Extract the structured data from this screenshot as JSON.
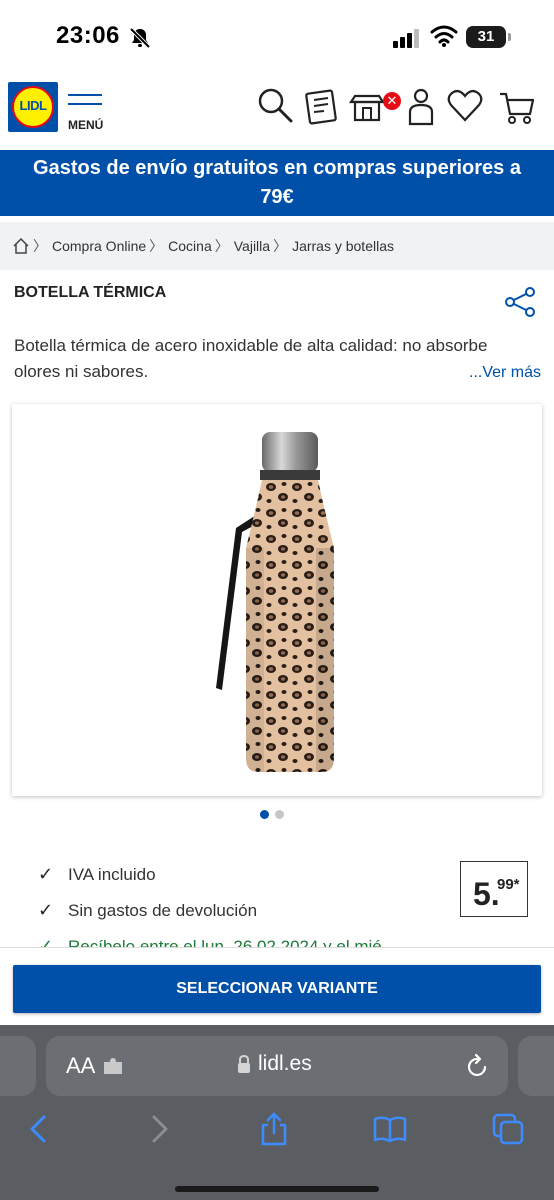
{
  "status_bar": {
    "time": "23:06",
    "battery": "31",
    "icons": [
      "bell-slash-icon",
      "signal-icon",
      "wifi-icon",
      "battery-icon"
    ]
  },
  "header": {
    "logo_text": "LIDL",
    "menu_label": "MENÚ",
    "icons": [
      "search-icon",
      "brochure-icon",
      "store-icon",
      "user-icon",
      "heart-icon",
      "cart-icon"
    ],
    "store_badge": "✕"
  },
  "banner": {
    "text": "Gastos de envío gratuitos en compras superiores a 79€"
  },
  "breadcrumb": {
    "items": [
      "Compra Online",
      "Cocina",
      "Vajilla",
      "Jarras y botellas"
    ]
  },
  "product": {
    "title": "BOTELLA TÉRMICA",
    "description": "Botella térmica de acero inoxidable de alta calidad: no absorbe olores ni sabores.",
    "more_link": "...Ver más",
    "carousel_pages": 2,
    "carousel_active": 1
  },
  "benefits": {
    "iva": "IVA incluido",
    "returns": "Sin gastos de devolución",
    "delivery": "Recíbelo entre el lun, 26.02.2024 y el mié"
  },
  "price": {
    "integer": "5.",
    "decimal": "99*"
  },
  "cta": {
    "label": "SELECCIONAR VARIANTE"
  },
  "safari": {
    "aa_label": "AA",
    "url": "lidl.es",
    "toolbar": [
      "back-icon",
      "forward-icon",
      "share-icon",
      "bookmarks-icon",
      "tabs-icon"
    ]
  },
  "colors": {
    "brand_blue": "#0050aa",
    "brand_yellow": "#fff000",
    "brand_red": "#e60a14",
    "success_green": "#1d7a3a"
  }
}
